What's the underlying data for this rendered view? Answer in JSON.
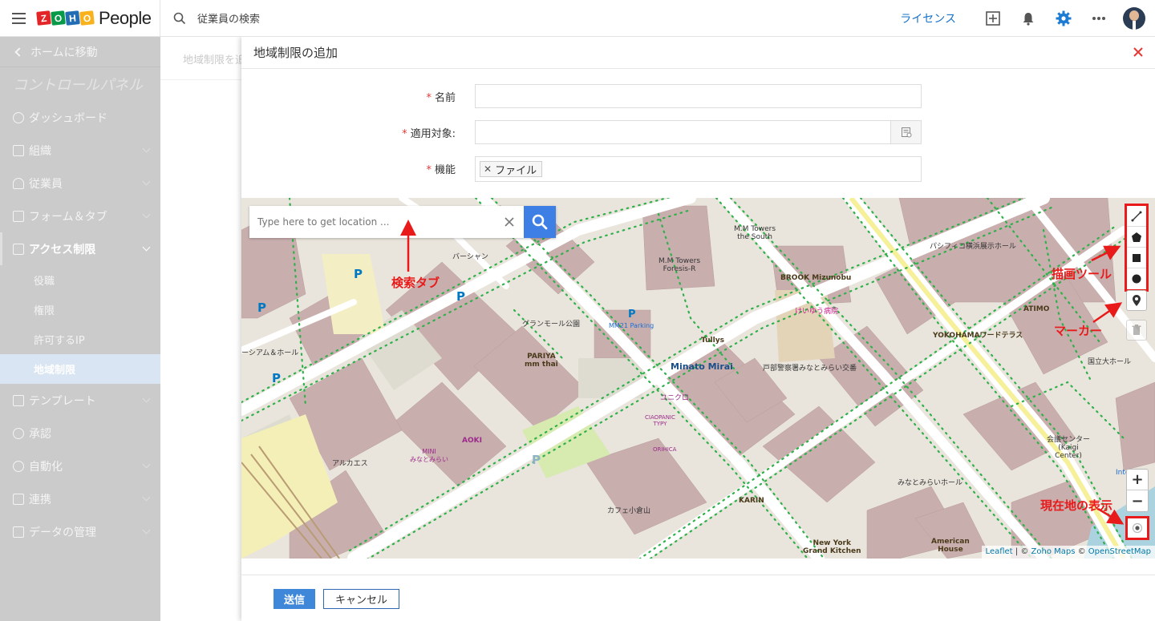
{
  "app": {
    "brand_letters": [
      "Z",
      "O",
      "H",
      "O"
    ],
    "brand_colors": [
      "#e42527",
      "#089949",
      "#226db4",
      "#f9b21d"
    ],
    "name": "People"
  },
  "topbar": {
    "search_placeholder": "従業員の検索",
    "license_label": "ライセンス"
  },
  "sidebar": {
    "back_label": "ホームに移動",
    "panel_title": "コントロールパネル",
    "items": [
      {
        "label": "ダッシュボード",
        "icon": "check-circle-icon"
      },
      {
        "label": "組織",
        "icon": "building-icon"
      },
      {
        "label": "従業員",
        "icon": "person-icon"
      },
      {
        "label": "フォーム＆タブ",
        "icon": "form-icon"
      },
      {
        "label": "アクセス制限",
        "icon": "document-icon"
      },
      {
        "label": "テンプレート",
        "icon": "template-icon"
      },
      {
        "label": "承認",
        "icon": "approval-icon"
      },
      {
        "label": "自動化",
        "icon": "automation-icon"
      },
      {
        "label": "連携",
        "icon": "integration-icon"
      },
      {
        "label": "データの管理",
        "icon": "data-icon"
      }
    ],
    "subitems": [
      "役職",
      "権限",
      "許可するIP",
      "地域制限"
    ]
  },
  "behind": {
    "crumb": "地域制限を追加"
  },
  "panel": {
    "title": "地域制限の追加",
    "form": {
      "name_label": "名前",
      "target_label": "適用対象:",
      "function_label": "機能",
      "function_chip": "ファイル"
    },
    "map": {
      "search_placeholder": "Type here to get location ...",
      "annotations": {
        "search_tab": "検索タブ",
        "draw_tools": "描画ツール",
        "marker": "マーカー",
        "current_location": "現在地の表示"
      },
      "labels": {
        "mm_towers_south": "M.M Towers\nthe South",
        "mm_towers_foresis": "M.M Towers\nForesis-R",
        "brook": "BROOK Mizunobu",
        "pacifico": "パシフィコ横浜展示ホール",
        "minato_mirai": "Minato Mirai",
        "tullys": "Tullys",
        "pariya": "PARIYA\nmm thai",
        "grand_mall": "グランモール公園",
        "mm21_parking": "MM21 Parking",
        "yokohama_world": "YOKOHAMAワードテラス",
        "atimo": "ATIMO",
        "hospital": "けいゆう病院",
        "kokuritsu": "国立大ホール",
        "karin": "KARIN",
        "aoki": "AOKI",
        "uniqlo": "ユニクロ",
        "kaigi": "会議センター\n(Kaigi\nCenter)",
        "minatomirai_hall": "みなとみらいホール",
        "nygk": "New York\nGrand Kitchen",
        "american_house": "American\nHouse",
        "alcatraz": "アルカエス",
        "ciaopanic": "CIAOPANIC\nTYPY",
        "oriha": "ORIHICA",
        "mini": "MINI\nみなとみらい",
        "cafe": "カフェ小倉山",
        "jinshin": "戸部警察署みなとみらい交番",
        "intercon": "Intercon",
        "seaside": "ーシアム＆ホール",
        "barsan": "バーシャン"
      },
      "attribution": {
        "leaflet": "Leaflet",
        "zoho": "Zoho Maps",
        "osm": "OpenStreetMap",
        "sep": " | © ",
        "copy": " © "
      }
    },
    "buttons": {
      "submit": "送信",
      "cancel": "キャンセル"
    }
  }
}
